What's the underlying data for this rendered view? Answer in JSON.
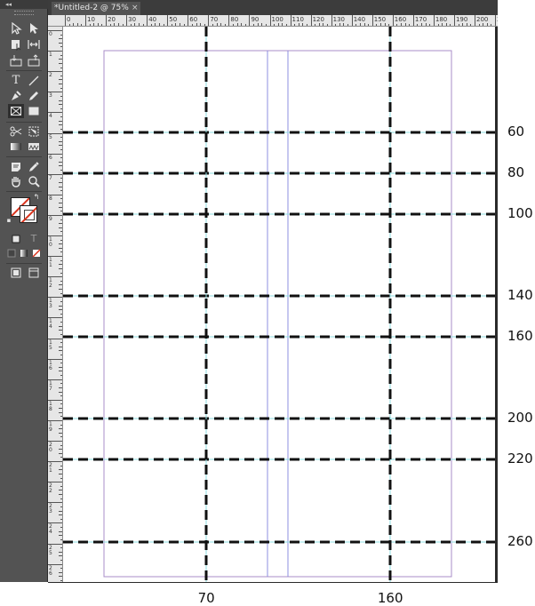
{
  "tab": {
    "title": "*Untitled-2 @ 75%",
    "close": "×"
  },
  "toolbar": {
    "collapse": "◂◂"
  },
  "ruler": {
    "h_labels": [
      "0",
      "10",
      "20",
      "30",
      "40",
      "50",
      "60",
      "70",
      "80",
      "90",
      "100",
      "110",
      "120",
      "130",
      "140",
      "150",
      "160",
      "170",
      "180",
      "190",
      "200",
      "2"
    ],
    "v_labels": [
      "0",
      "1",
      "2",
      "3",
      "4",
      "5",
      "6",
      "7",
      "8",
      "9",
      "10",
      "11",
      "12",
      "13",
      "14",
      "15",
      "16",
      "17",
      "18",
      "19",
      "20",
      "21",
      "22",
      "23",
      "24",
      "25",
      "26",
      "27"
    ]
  },
  "guides": {
    "horizontal": [
      "60",
      "80",
      "100",
      "140",
      "160",
      "200",
      "220",
      "260"
    ],
    "vertical": [
      "70",
      "160"
    ]
  },
  "colors": {
    "guide_cyan": "#8fdde0",
    "margin_purple": "#a98cc9",
    "column_blue": "#8d8fe0",
    "dash": "#111111"
  }
}
